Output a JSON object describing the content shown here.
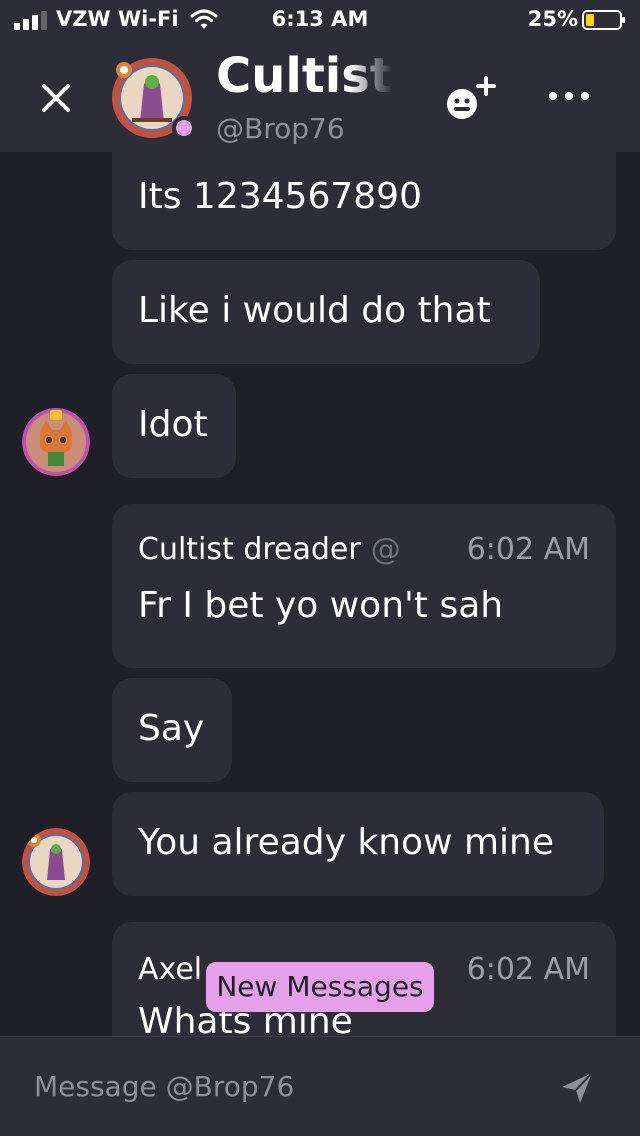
{
  "status_bar": {
    "carrier": "VZW Wi-Fi",
    "time": "6:13 AM",
    "battery_percent": "25%",
    "battery_level": 0.25,
    "icons": [
      "signal-icon",
      "wifi-icon",
      "battery-icon"
    ]
  },
  "header": {
    "title": "Cultist",
    "handle": "@Brop76",
    "presence_color": "#e6a0ea",
    "icons": [
      "close-icon",
      "add-friend-icon",
      "more-icon"
    ]
  },
  "messages": [
    {
      "text": "Its 1234567890"
    },
    {
      "text": "Like i would do that"
    },
    {
      "text": "Idot"
    },
    {
      "author": "Cultist dreader",
      "handle": "@B",
      "time": "6:02 AM",
      "text": "Fr I bet yo won't sah"
    },
    {
      "text": "Say"
    },
    {
      "text": "You already know mine"
    },
    {
      "author": "Axel",
      "time": "6:02 AM",
      "text": "Whats mine"
    }
  ],
  "new_messages_label": "New Messages",
  "composer": {
    "placeholder": "Message @Brop76"
  },
  "colors": {
    "background": "#1e1f27",
    "bubble": "#2c2d36",
    "accent": "#e6a0ea"
  }
}
